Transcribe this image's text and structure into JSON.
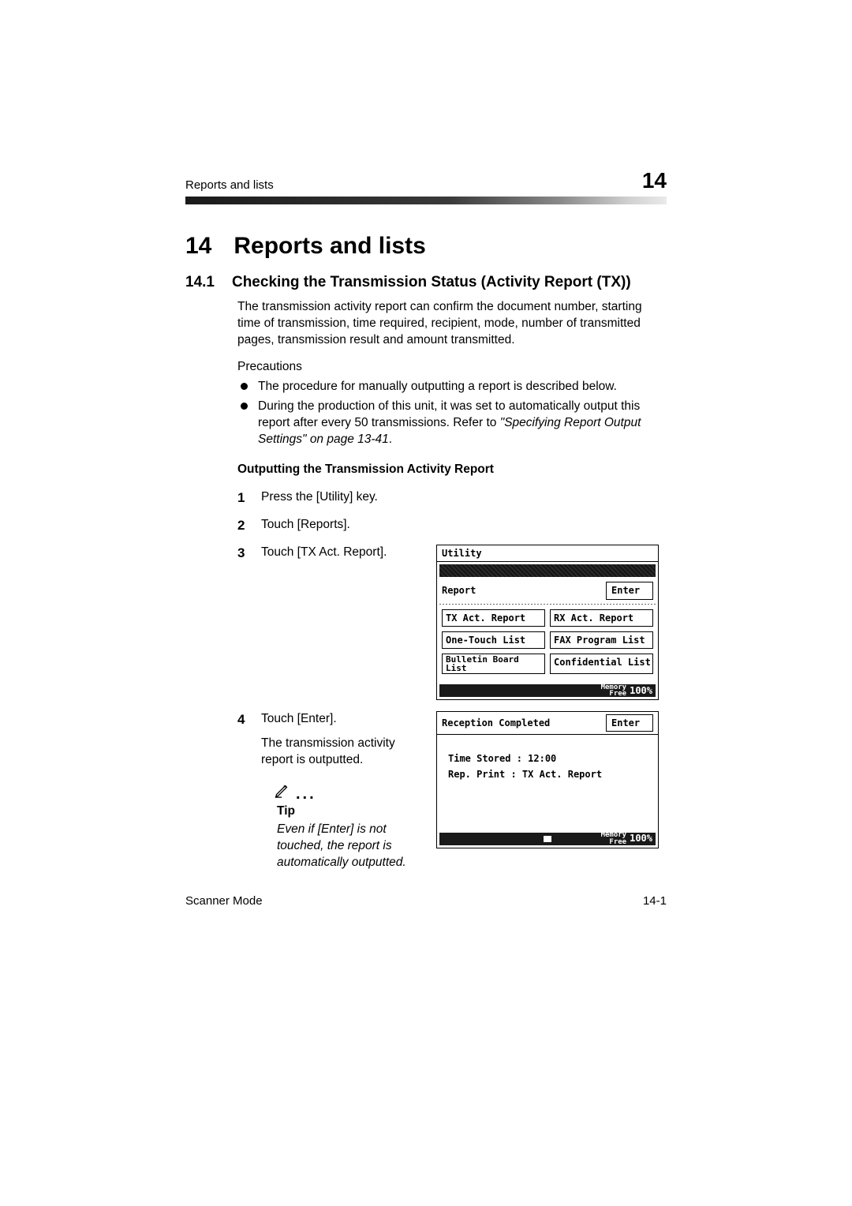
{
  "running_head": {
    "left": "Reports and lists",
    "right": "14"
  },
  "chapter": {
    "number": "14",
    "title": "Reports and lists"
  },
  "section": {
    "number": "14.1",
    "title": "Checking the Transmission Status (Activity Report (TX))"
  },
  "intro_para": "The transmission activity report can confirm the document number, starting time of transmission, time required, recipient, mode, number of transmitted pages, transmission result and amount transmitted.",
  "precautions_label": "Precautions",
  "bullets": {
    "b1": "The procedure for manually outputting a report is described below.",
    "b2_pre": "During the production of this unit, it was set to automatically output this report after every 50 transmissions. Refer to ",
    "b2_ref": "\"Specifying Report Output Settings\" on page 13-41",
    "b2_post": "."
  },
  "output_heading": "Outputting the Transmission Activity Report",
  "steps": {
    "s1": "Press the [Utility] key.",
    "s2": "Touch [Reports].",
    "s3": "Touch [TX Act. Report].",
    "s4": "Touch [Enter].",
    "s4_sub": "The transmission activity report is outputted."
  },
  "tip": {
    "title": "Tip",
    "body": "Even if [Enter] is not touched, the report is automatically outputted."
  },
  "lcd1": {
    "title": "Utility",
    "report_label": "Report",
    "enter": "Enter",
    "btn_tx": "TX Act. Report",
    "btn_rx": "RX Act. Report",
    "btn_onetouch": "One-Touch List",
    "btn_faxprog": "FAX Program List",
    "btn_bulletin": "Bulletin Board\nList",
    "btn_conf": "Confidential List",
    "mem_label": "Memory\nFree",
    "mem_pct": "100%"
  },
  "lcd2": {
    "title": "Reception Completed",
    "enter": "Enter",
    "time_line": "Time Stored : 12:00",
    "rep_line": "Rep. Print : TX Act. Report",
    "mem_label": "Memory\nFree",
    "mem_pct": "100%"
  },
  "footer": {
    "left": "Scanner Mode",
    "right": "14-1"
  }
}
